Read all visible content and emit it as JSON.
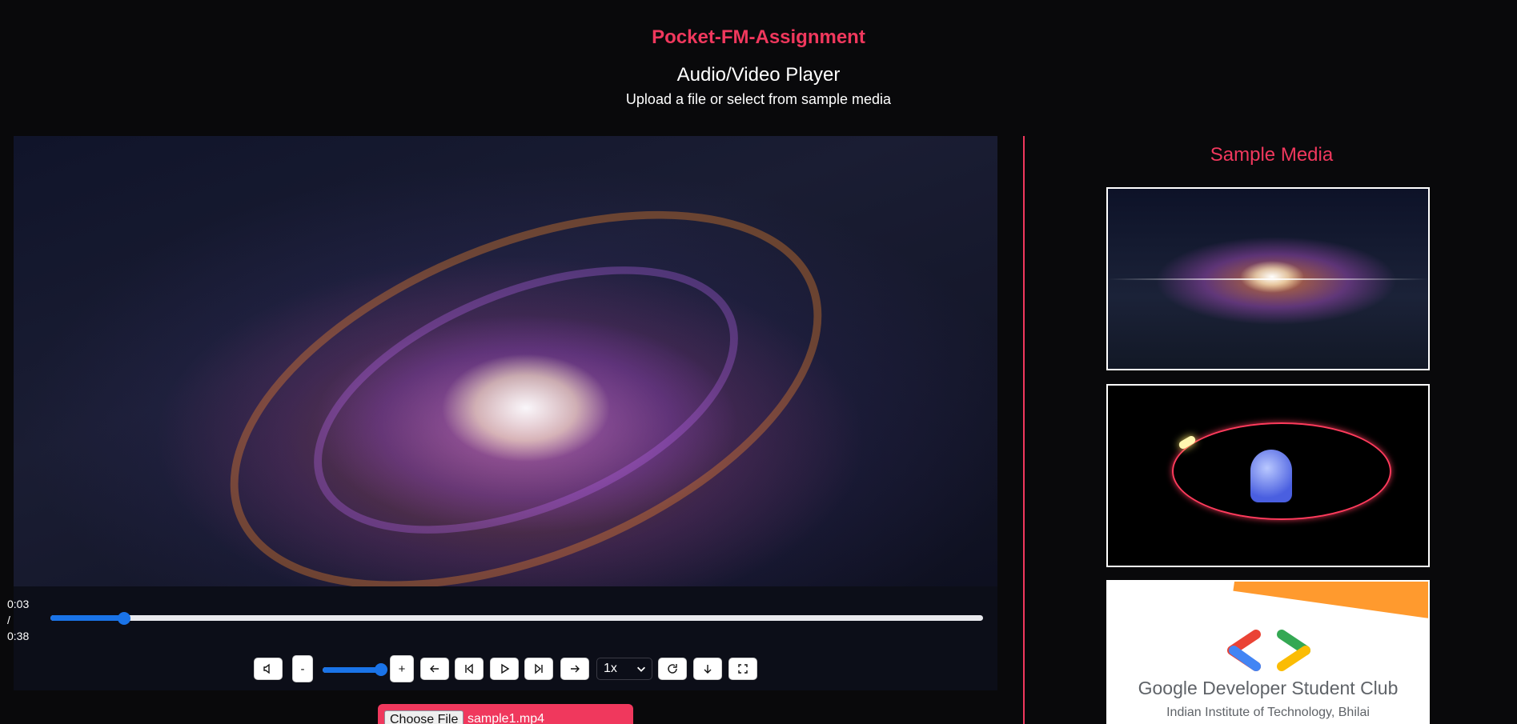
{
  "header": {
    "app_title": "Pocket-FM-Assignment",
    "player_title": "Audio/Video Player",
    "subtitle": "Upload a file or select from sample media"
  },
  "player": {
    "current_time": "0:03",
    "separator": "/",
    "duration": "0:38",
    "progress_fraction": 0.079,
    "volume_fraction": 1.0,
    "buttons": {
      "mute_icon": "speaker-icon",
      "volume_down_label": "-",
      "volume_up_label": "+",
      "rewind_icon": "arrow-left-icon",
      "previous_icon": "skip-back-icon",
      "play_icon": "play-icon",
      "next_icon": "skip-forward-icon",
      "forward_icon": "arrow-right-icon",
      "replay_icon": "rotate-icon",
      "download_icon": "arrow-down-icon",
      "fullscreen_icon": "fullscreen-icon"
    },
    "speed": {
      "selected": "1x"
    },
    "accent_color": "#1a73e8"
  },
  "upload": {
    "choose_file_label": "Choose File",
    "file_name": "sample1.mp4"
  },
  "sidebar": {
    "title": "Sample Media",
    "items": [
      {
        "thumbnail": "galaxy-video-thumbnail"
      },
      {
        "thumbnail": "orbit-video-thumbnail"
      },
      {
        "thumbnail": "gdsc-image-thumbnail",
        "name": "Google Developer Student Club",
        "institute": "Indian Institute of Technology, Bhilai"
      }
    ]
  },
  "colors": {
    "brand": "#f0385d",
    "background": "#09090b"
  }
}
